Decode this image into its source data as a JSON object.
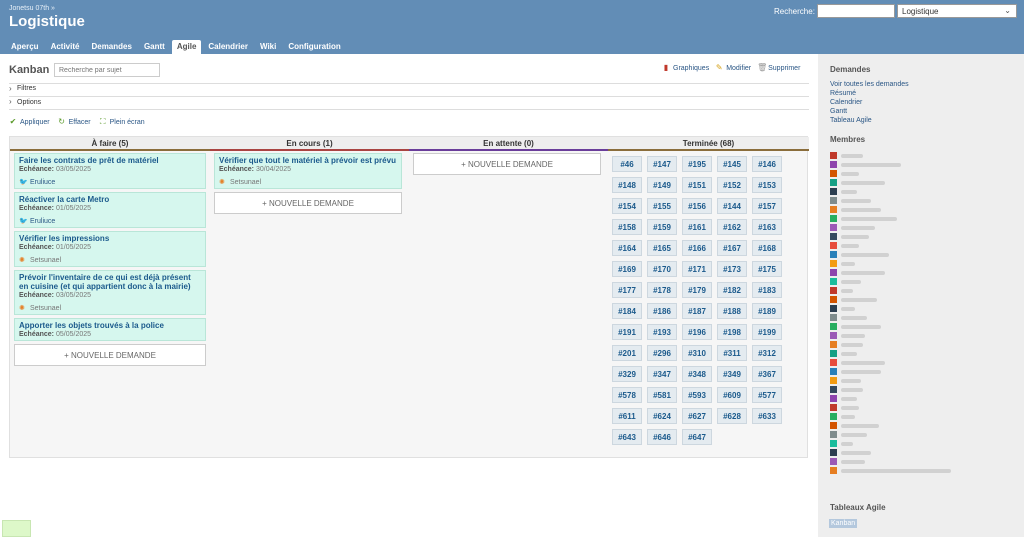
{
  "header": {
    "parent_project": "Jonetsu 07th »",
    "title": "Logistique",
    "search_label": "Recherche:",
    "project_select": "Logistique"
  },
  "menu": [
    {
      "label": "Aperçu"
    },
    {
      "label": "Activité"
    },
    {
      "label": "Demandes"
    },
    {
      "label": "Gantt"
    },
    {
      "label": "Agile",
      "selected": true
    },
    {
      "label": "Calendrier"
    },
    {
      "label": "Wiki"
    },
    {
      "label": "Configuration"
    }
  ],
  "page": {
    "title": "Kanban",
    "search_placeholder": "Recherche par sujet",
    "actions": {
      "charts": "Graphiques",
      "edit": "Modifier",
      "delete": "Supprimer"
    },
    "filters_label": "Filtres",
    "options_label": "Options",
    "query_buttons": {
      "apply": "Appliquer",
      "clear": "Effacer",
      "fullscreen": "Plein écran"
    }
  },
  "board": {
    "due_label": "Echéance:",
    "new_issue_label": "+ NOUVELLE DEMANDE",
    "columns": [
      {
        "title": "À faire (5)",
        "color": "#8a6d3b"
      },
      {
        "title": "En cours (1)",
        "color": "#a94442"
      },
      {
        "title": "En attente (0)",
        "color": "#6a3d9a"
      },
      {
        "title": "Terminée (68)",
        "color": "#8a6d3b"
      }
    ],
    "todo": [
      {
        "title": "Faire les contrats de prêt de matériel",
        "due": "03/05/2025",
        "user": "Eruliuce",
        "user_color": "#2a5685"
      },
      {
        "title": "Réactiver la carte Metro",
        "due": "01/05/2025",
        "user": "Eruliuce",
        "user_color": "#2a5685"
      },
      {
        "title": "Vérifier les impressions",
        "due": "01/05/2025",
        "user": "Setsunael",
        "user_color": "#777"
      },
      {
        "title": "Prévoir l'inventaire de ce qui est déjà présent en cuisine (et qui appartient donc à la mairie)",
        "due": "03/05/2025",
        "user": "Setsunael",
        "user_color": "#777"
      },
      {
        "title": "Apporter les objets trouvés à la police",
        "due": "05/05/2025",
        "user": "",
        "user_color": ""
      }
    ],
    "in_progress": [
      {
        "title": "Vérifier que tout le matériel à prévoir est prévu",
        "due": "30/04/2025",
        "user": "Setsunael",
        "user_color": "#777"
      }
    ],
    "closed": [
      "#46",
      "#147",
      "#195",
      "#145",
      "#146",
      "#148",
      "#149",
      "#151",
      "#152",
      "#153",
      "#154",
      "#155",
      "#156",
      "#144",
      "#157",
      "#158",
      "#159",
      "#161",
      "#162",
      "#163",
      "#164",
      "#165",
      "#166",
      "#167",
      "#168",
      "#169",
      "#170",
      "#171",
      "#173",
      "#175",
      "#177",
      "#178",
      "#179",
      "#182",
      "#183",
      "#184",
      "#186",
      "#187",
      "#188",
      "#189",
      "#191",
      "#193",
      "#196",
      "#198",
      "#199",
      "#201",
      "#296",
      "#310",
      "#311",
      "#312",
      "#329",
      "#347",
      "#348",
      "#349",
      "#367",
      "#578",
      "#581",
      "#593",
      "#609",
      "#577",
      "#611",
      "#624",
      "#627",
      "#628",
      "#633",
      "#643",
      "#646",
      "#647"
    ]
  },
  "sidebar": {
    "requests_heading": "Demandes",
    "requests_links": [
      "Voir toutes les demandes",
      "Résumé",
      "Calendrier",
      "Gantt",
      "Tableau Agile"
    ],
    "members_heading": "Membres",
    "agile_heading": "Tableaux Agile",
    "agile_link": "Kanban"
  }
}
